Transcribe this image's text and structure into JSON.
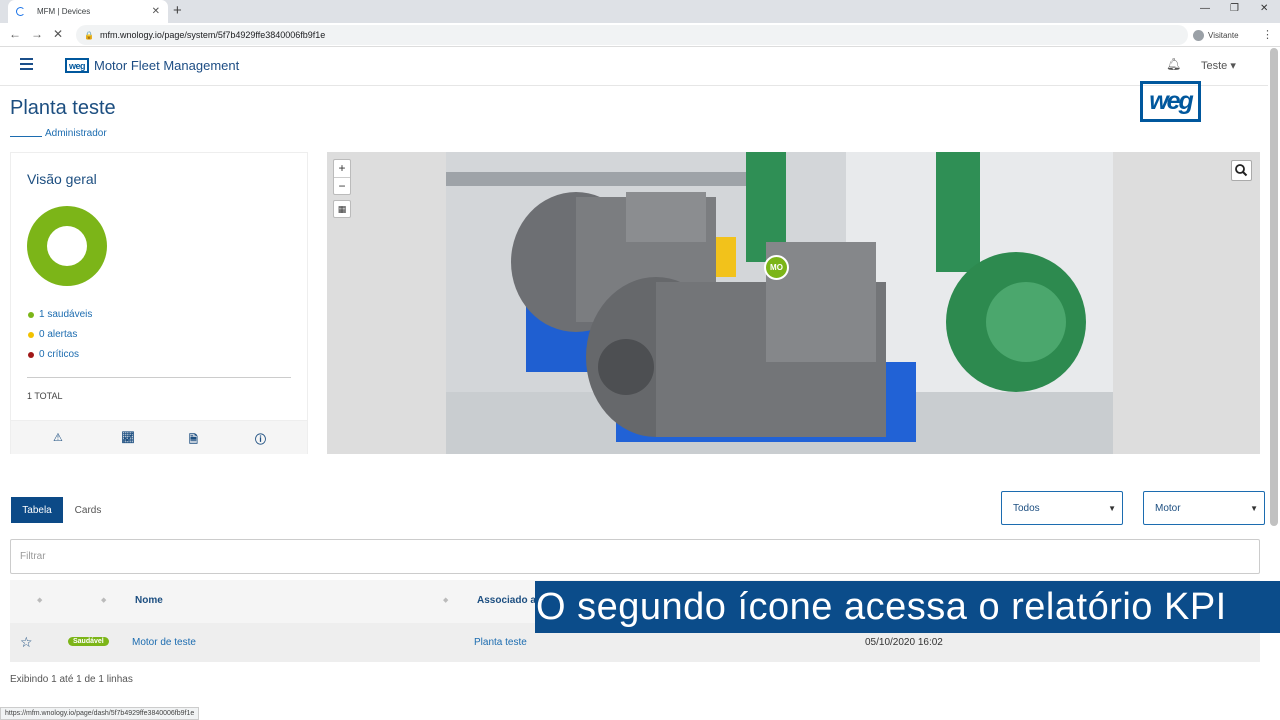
{
  "browser": {
    "tab_title": "MFM | Devices",
    "new_tab": "+",
    "url": "mfm.wnology.io/page/system/5f7b4929ffe3840006fb9f1e",
    "profile_label": "Visitante",
    "status_url": "https://mfm.wnology.io/page/dash/5f7b4929ffe3840006fb9f1e"
  },
  "app": {
    "logo_text": "weg",
    "title": "Motor Fleet Management",
    "user": "Teste"
  },
  "page": {
    "title": "Planta teste",
    "role": "Administrador"
  },
  "overview": {
    "title": "Visão geral",
    "healthy": "1 saudáveis",
    "alerts": "0 alertas",
    "critical": "0 críticos",
    "total": "1 TOTAL",
    "colors": {
      "healthy": "#7cb518",
      "alerts": "#f2c200",
      "critical": "#a01818"
    }
  },
  "map": {
    "zoom_in": "+",
    "zoom_out": "−",
    "marker_label": "MO"
  },
  "view_tabs": {
    "table": "Tabela",
    "cards": "Cards"
  },
  "filters": {
    "status_select": "Todos",
    "type_select": "Motor",
    "filter_placeholder": "Filtrar"
  },
  "table": {
    "columns": {
      "name": "Nome",
      "associated": "Associado a"
    },
    "rows": [
      {
        "status": "Saudável",
        "name": "Motor de teste",
        "associated": "Planta teste",
        "date": "05/10/2020 16:02"
      }
    ],
    "paging": "Exibindo 1 até 1 de 1 linhas"
  },
  "caption": "O segundo ícone acessa o relatório KPI"
}
